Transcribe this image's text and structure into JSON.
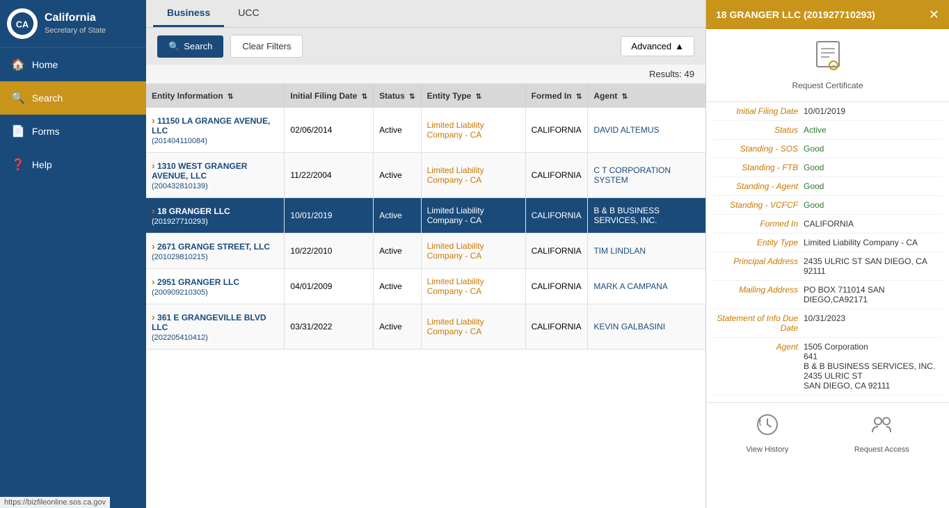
{
  "sidebar": {
    "state_name": "California",
    "dept_name": "Secretary of State",
    "nav_items": [
      {
        "id": "home",
        "label": "Home",
        "icon": "🏠"
      },
      {
        "id": "search",
        "label": "Search",
        "icon": "🔍",
        "active": true
      },
      {
        "id": "forms",
        "label": "Forms",
        "icon": "📄"
      },
      {
        "id": "help",
        "label": "Help",
        "icon": "❓"
      }
    ]
  },
  "tabs": [
    {
      "id": "business",
      "label": "Business",
      "active": true
    },
    {
      "id": "ucc",
      "label": "UCC",
      "active": false
    }
  ],
  "toolbar": {
    "search_label": "Search",
    "clear_label": "Clear Filters",
    "advanced_label": "Advanced"
  },
  "results": {
    "count_label": "Results: 49",
    "columns": [
      {
        "id": "entity_info",
        "label": "Entity Information"
      },
      {
        "id": "filing_date",
        "label": "Initial Filing Date"
      },
      {
        "id": "status",
        "label": "Status"
      },
      {
        "id": "entity_type",
        "label": "Entity Type"
      },
      {
        "id": "formed_in",
        "label": "Formed In"
      },
      {
        "id": "agent",
        "label": "Agent"
      }
    ],
    "rows": [
      {
        "id": "row1",
        "entity_name": "11150 LA GRANGE AVENUE, LLC",
        "entity_number": "(201404110084)",
        "filing_date": "02/06/2014",
        "status": "Active",
        "entity_type": "Limited Liability Company - CA",
        "formed_in": "CALIFORNIA",
        "agent": "DAVID ALTEMUS",
        "selected": false
      },
      {
        "id": "row2",
        "entity_name": "1310 WEST GRANGER AVENUE, LLC",
        "entity_number": "(200432810139)",
        "filing_date": "11/22/2004",
        "status": "Active",
        "entity_type": "Limited Liability Company - CA",
        "formed_in": "CALIFORNIA",
        "agent": "C T CORPORATION SYSTEM",
        "selected": false
      },
      {
        "id": "row3",
        "entity_name": "18 GRANGER LLC",
        "entity_number": "(201927710293)",
        "filing_date": "10/01/2019",
        "status": "Active",
        "entity_type": "Limited Liability Company - CA",
        "formed_in": "CALIFORNIA",
        "agent": "B & B BUSINESS SERVICES, INC.",
        "selected": true
      },
      {
        "id": "row4",
        "entity_name": "2671 GRANGE STREET, LLC",
        "entity_number": "(201029810215)",
        "filing_date": "10/22/2010",
        "status": "Active",
        "entity_type": "Limited Liability Company - CA",
        "formed_in": "CALIFORNIA",
        "agent": "TIM LINDLAN",
        "selected": false
      },
      {
        "id": "row5",
        "entity_name": "2951 GRANGER LLC",
        "entity_number": "(200909210305)",
        "filing_date": "04/01/2009",
        "status": "Active",
        "entity_type": "Limited Liability Company - CA",
        "formed_in": "CALIFORNIA",
        "agent": "MARK A CAMPANA",
        "selected": false
      },
      {
        "id": "row6",
        "entity_name": "361 E GRANGEVILLE BLVD LLC",
        "entity_number": "(202205410412)",
        "filing_date": "03/31/2022",
        "status": "Active",
        "entity_type": "Limited Liability Company - CA",
        "formed_in": "CALIFORNIA",
        "agent": "KEVIN GALBASINI",
        "selected": false
      }
    ]
  },
  "detail_panel": {
    "title": "18 GRANGER LLC (201927710293)",
    "cert_label": "Request Certificate",
    "fields": [
      {
        "label": "Initial Filing Date",
        "value": "10/01/2019",
        "class": ""
      },
      {
        "label": "Status",
        "value": "Active",
        "class": "active"
      },
      {
        "label": "Standing - SOS",
        "value": "Good",
        "class": "good"
      },
      {
        "label": "Standing - FTB",
        "value": "Good",
        "class": "good"
      },
      {
        "label": "Standing - Agent",
        "value": "Good",
        "class": "good"
      },
      {
        "label": "Standing - VCFCF",
        "value": "Good",
        "class": "good"
      },
      {
        "label": "Formed In",
        "value": "CALIFORNIA",
        "class": ""
      },
      {
        "label": "Entity Type",
        "value": "Limited Liability Company - CA",
        "class": ""
      },
      {
        "label": "Principal Address",
        "value": "2435 ULRIC ST SAN DIEGO, CA 92111",
        "class": ""
      },
      {
        "label": "Mailing Address",
        "value": "PO BOX 711014 SAN DIEGO,CA92171",
        "class": ""
      },
      {
        "label": "Statement of Info Due Date",
        "value": "10/31/2023",
        "class": ""
      },
      {
        "label": "Agent",
        "value": "1505 Corporation\n641\nB & B BUSINESS SERVICES, INC.\n2435 ULRIC ST\nSAN DIEGO, CA  92111",
        "class": ""
      }
    ],
    "view_history_label": "View History",
    "request_access_label": "Request Access"
  },
  "url_bar": "https://bizfileonline.sos.ca.gov"
}
